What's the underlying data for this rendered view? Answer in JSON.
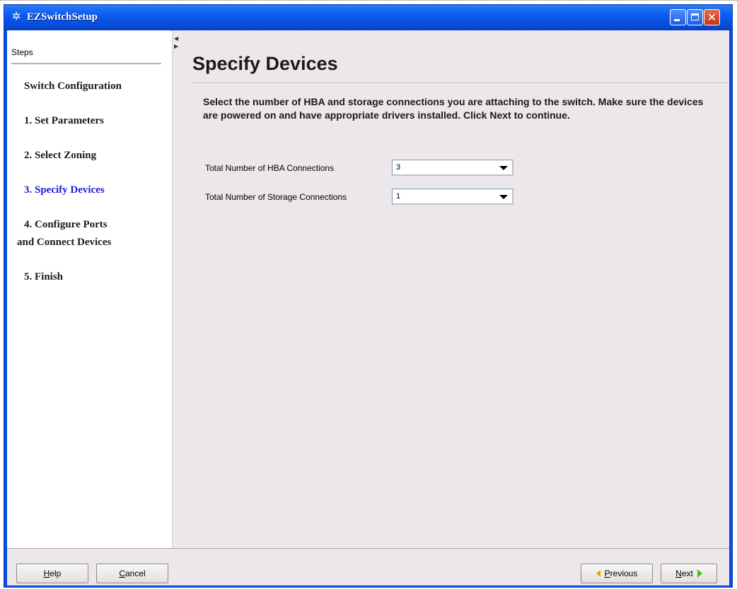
{
  "window": {
    "title": "EZSwitchSetup",
    "app_icon": "gear-icon",
    "controls": [
      "minimize-icon",
      "maximize-icon",
      "close-icon"
    ]
  },
  "sidebar": {
    "header": "Steps",
    "items": [
      {
        "label": "Switch Configuration",
        "current": false
      },
      {
        "label": "1. Set Parameters",
        "current": false
      },
      {
        "label": "2. Select Zoning",
        "current": false
      },
      {
        "label": "3. Specify Devices",
        "current": true
      },
      {
        "label": "4. Configure Ports",
        "label2": "and Connect Devices",
        "current": false
      },
      {
        "label": "5. Finish",
        "current": false
      }
    ],
    "current_color": "#1c1cd8"
  },
  "main": {
    "title": "Specify Devices",
    "instructions": "Select the number of HBA and storage connections you are attaching to the switch. Make sure the devices are powered on and have appropriate drivers installed. Click Next to continue.",
    "fields": [
      {
        "label": "Total Number of HBA Connections",
        "value": "3"
      },
      {
        "label": "Total Number of Storage Connections",
        "value": "1"
      }
    ]
  },
  "footer": {
    "help": {
      "mnemonic": "H",
      "rest": "elp"
    },
    "cancel": {
      "mnemonic": "C",
      "rest": "ancel"
    },
    "previous": {
      "mnemonic": "P",
      "rest": "revious"
    },
    "next": {
      "mnemonic": "N",
      "rest": "ext"
    }
  }
}
